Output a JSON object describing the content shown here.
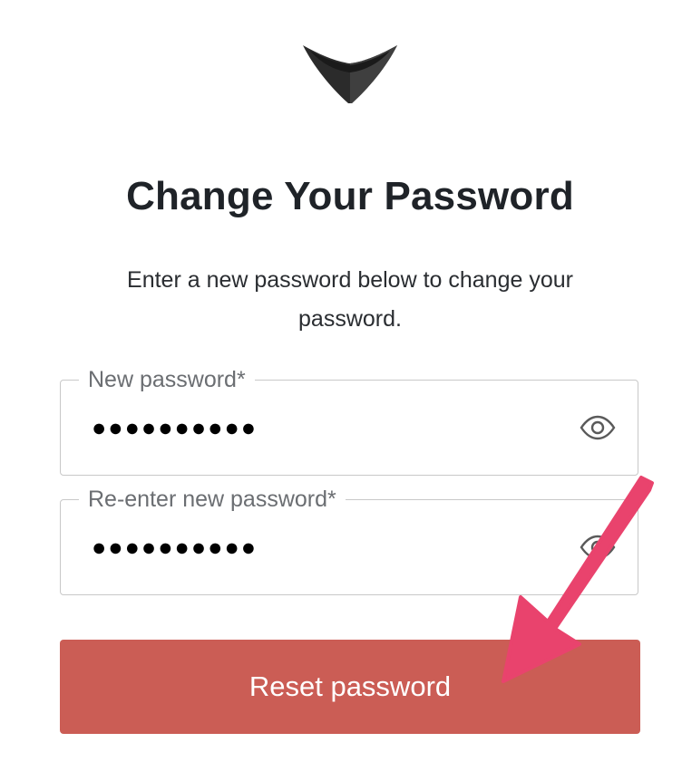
{
  "header": {
    "logo_icon": "chevron-shield-logo-icon"
  },
  "main": {
    "title": "Change Your Password",
    "subtitle": "Enter a new password below to change your password."
  },
  "form": {
    "new_password": {
      "label": "New password*",
      "value": "●●●●●●●●●●",
      "toggle_icon": "eye-icon"
    },
    "confirm_password": {
      "label": "Re-enter new password*",
      "value": "●●●●●●●●●●",
      "toggle_icon": "eye-icon"
    },
    "submit_label": "Reset password"
  },
  "annotation": {
    "arrow_icon": "pointer-arrow-icon",
    "arrow_color": "#e9436d"
  },
  "colors": {
    "button_background": "#cb5d55",
    "title_text": "#1f2328",
    "label_text": "#6b6e72",
    "border": "#c8c8c8"
  }
}
